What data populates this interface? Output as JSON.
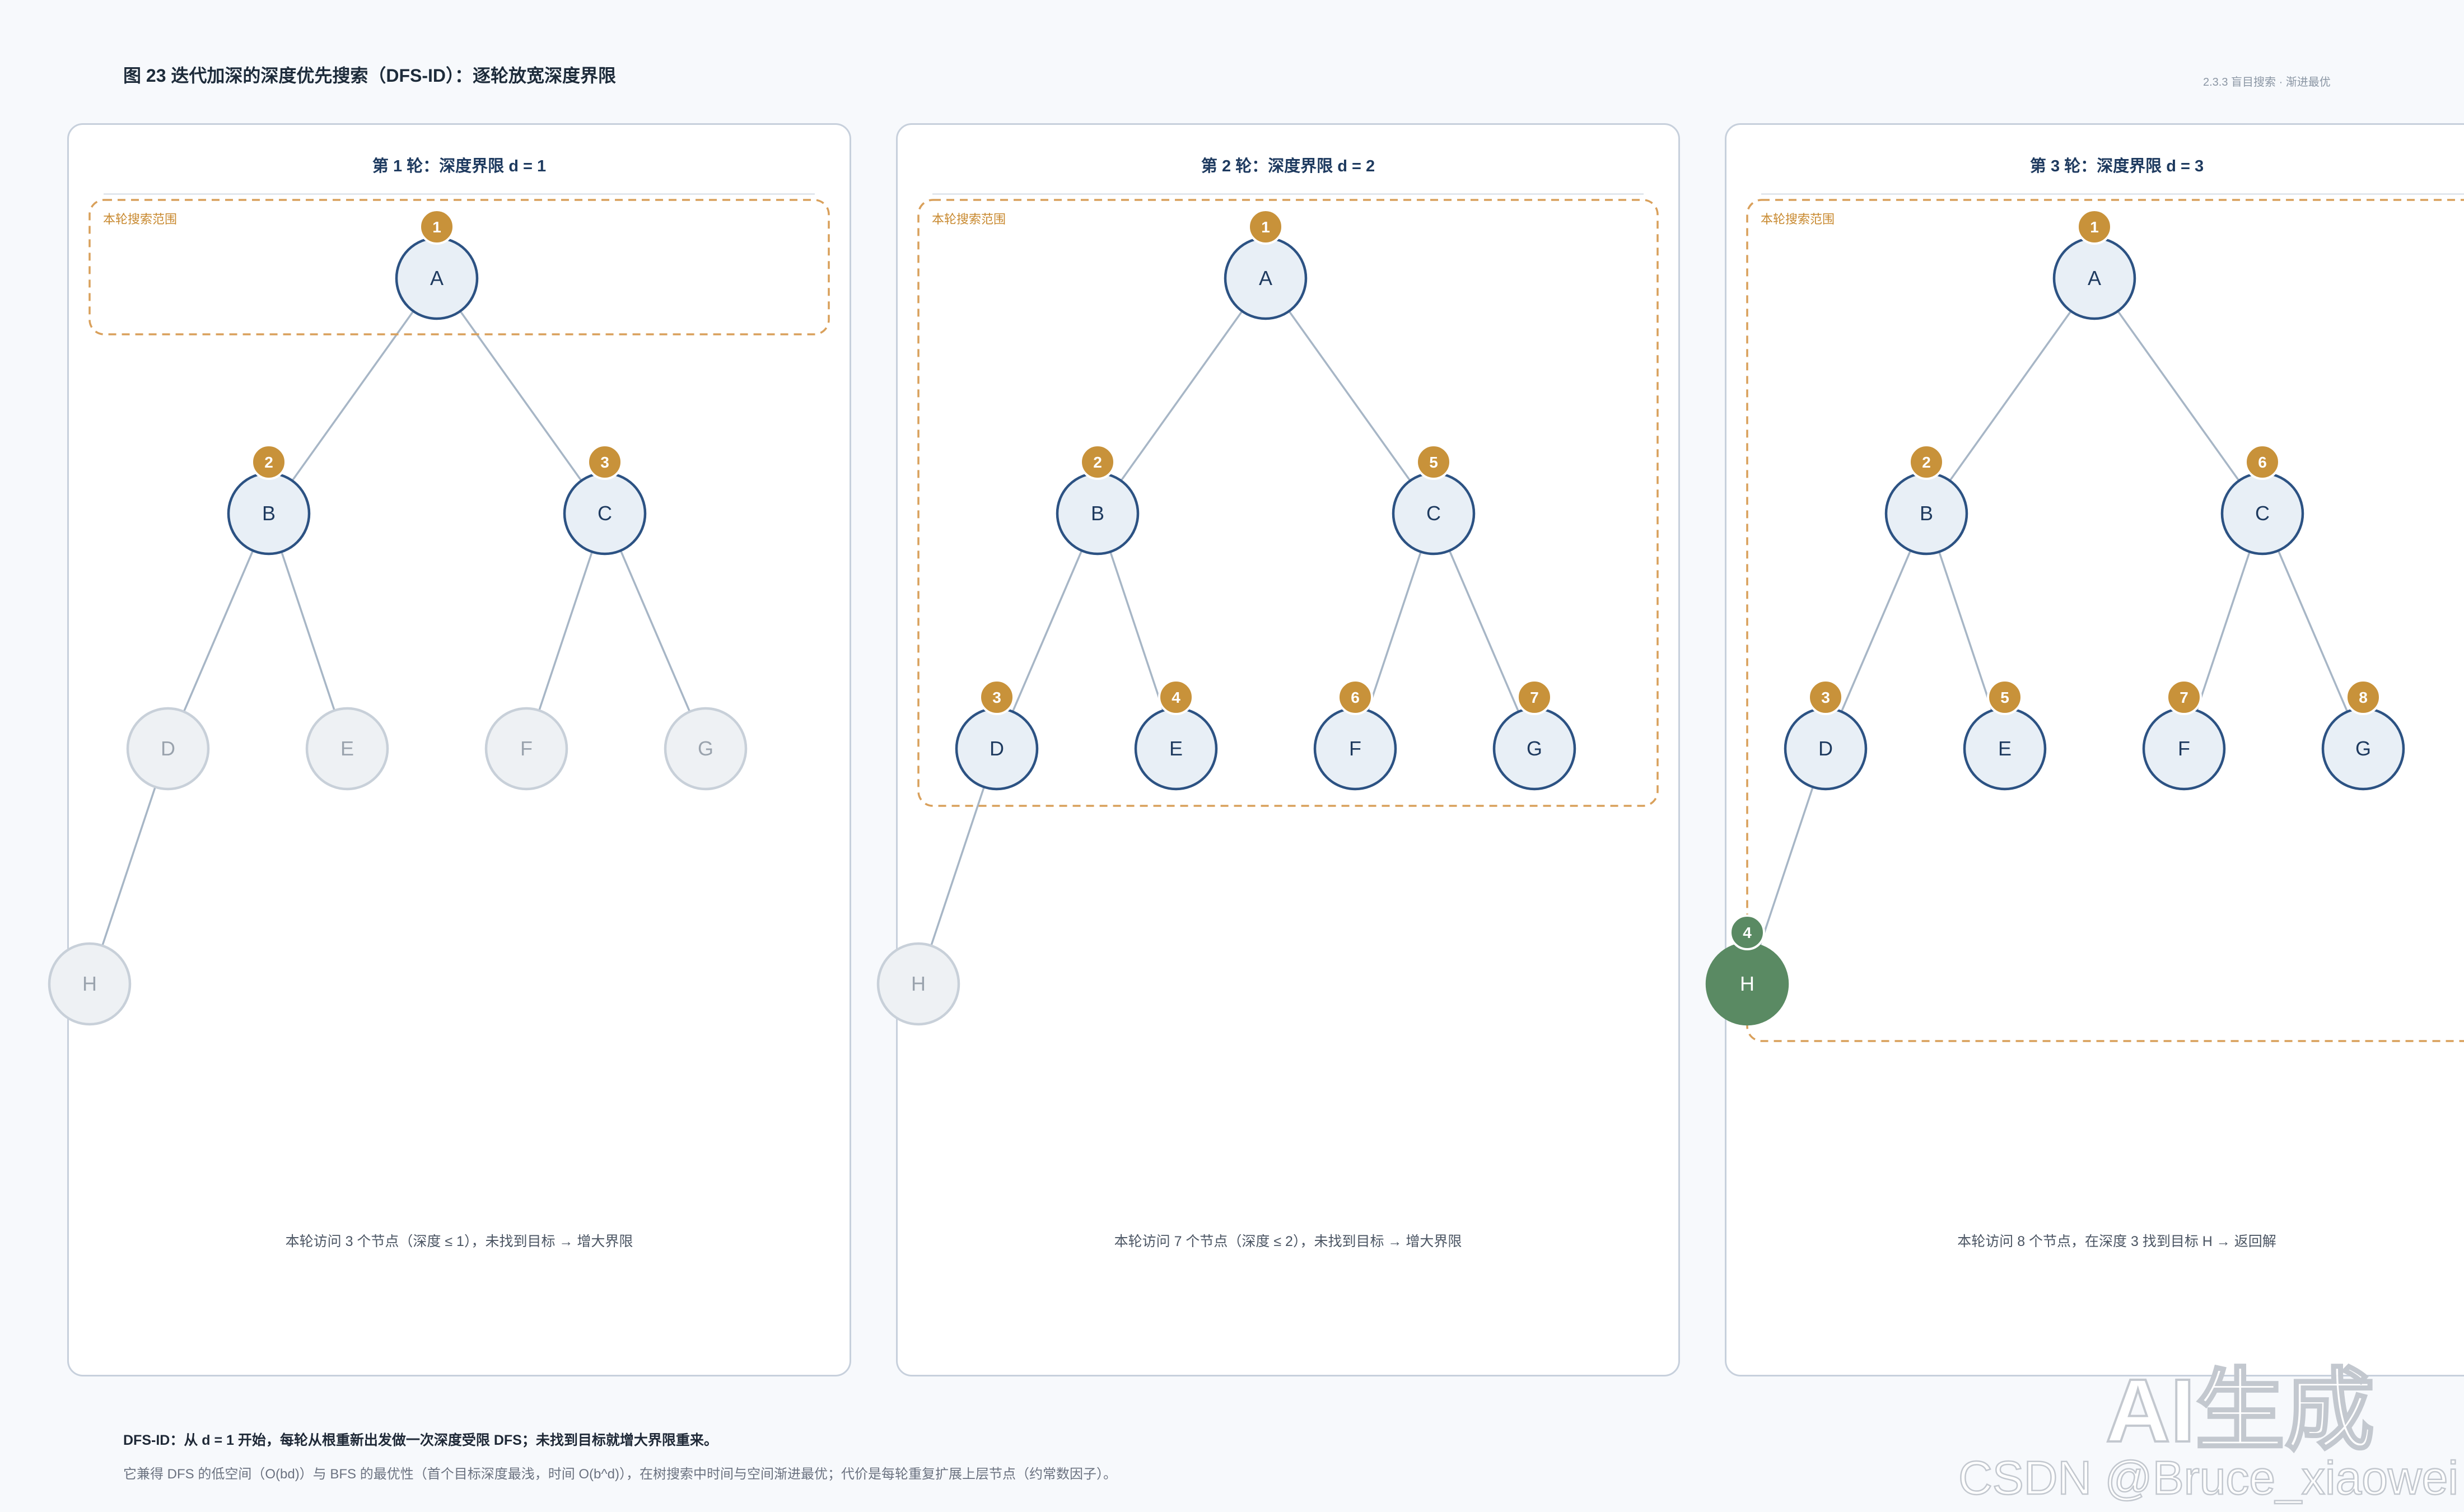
{
  "header": {
    "title": "图 23 迭代加深的深度优先搜索（DFS-ID）：逐轮放宽深度界限",
    "section": "2.3.3 盲目搜索 · 渐进最优"
  },
  "scope_label": "本轮搜索范围",
  "colors": {
    "node_fill": "#e8eff6",
    "node_stroke": "#2c5283",
    "dim_fill": "#eef1f4",
    "dim_stroke": "#c8d0d9",
    "order_badge": "#c8923a",
    "goal": "#5a8a63",
    "scope_border": "#d9a05b",
    "edge": "#a7b6c6"
  },
  "panels": [
    {
      "title": "第 1 轮：深度界限 d = 1",
      "caption": "本轮访问 3 个节点（深度 ≤ 1），未找到目标 → 增大界限",
      "nodes": [
        {
          "label": "A",
          "state": "visited",
          "order": "1"
        },
        {
          "label": "B",
          "state": "visited",
          "order": "2"
        },
        {
          "label": "C",
          "state": "visited",
          "order": "3"
        },
        {
          "label": "D",
          "state": "dim",
          "order": ""
        },
        {
          "label": "E",
          "state": "dim",
          "order": ""
        },
        {
          "label": "F",
          "state": "dim",
          "order": ""
        },
        {
          "label": "G",
          "state": "dim",
          "order": ""
        },
        {
          "label": "H",
          "state": "dim",
          "order": ""
        }
      ]
    },
    {
      "title": "第 2 轮：深度界限 d = 2",
      "caption": "本轮访问 7 个节点（深度 ≤ 2），未找到目标 → 增大界限",
      "nodes": [
        {
          "label": "A",
          "state": "visited",
          "order": "1"
        },
        {
          "label": "B",
          "state": "visited",
          "order": "2"
        },
        {
          "label": "C",
          "state": "visited",
          "order": "5"
        },
        {
          "label": "D",
          "state": "visited",
          "order": "3"
        },
        {
          "label": "E",
          "state": "visited",
          "order": "4"
        },
        {
          "label": "F",
          "state": "visited",
          "order": "6"
        },
        {
          "label": "G",
          "state": "visited",
          "order": "7"
        },
        {
          "label": "H",
          "state": "dim",
          "order": ""
        }
      ]
    },
    {
      "title": "第 3 轮：深度界限 d = 3",
      "caption": "本轮访问 8 个节点，在深度 3 找到目标 H → 返回解",
      "nodes": [
        {
          "label": "A",
          "state": "visited",
          "order": "1"
        },
        {
          "label": "B",
          "state": "visited",
          "order": "2"
        },
        {
          "label": "C",
          "state": "visited",
          "order": "6"
        },
        {
          "label": "D",
          "state": "visited",
          "order": "3"
        },
        {
          "label": "E",
          "state": "visited",
          "order": "5"
        },
        {
          "label": "F",
          "state": "visited",
          "order": "7"
        },
        {
          "label": "G",
          "state": "visited",
          "order": "8"
        },
        {
          "label": "H",
          "state": "goal",
          "order": "4"
        }
      ]
    }
  ],
  "footer": {
    "summary": "DFS-ID：从 d = 1 开始，每轮从根重新出发做一次深度受限 DFS；未找到目标就增大界限重来。",
    "note": "它兼得 DFS 的低空间（O(bd)）与 BFS 的最优性（首个目标深度最浅，时间 O(b^d)），在树搜索中时间与空间渐进最优；代价是每轮重复扩展上层节点（约常数因子）。"
  },
  "watermark": {
    "main": "AI生成",
    "sub": "CSDN @Bruce_xiaowei"
  }
}
